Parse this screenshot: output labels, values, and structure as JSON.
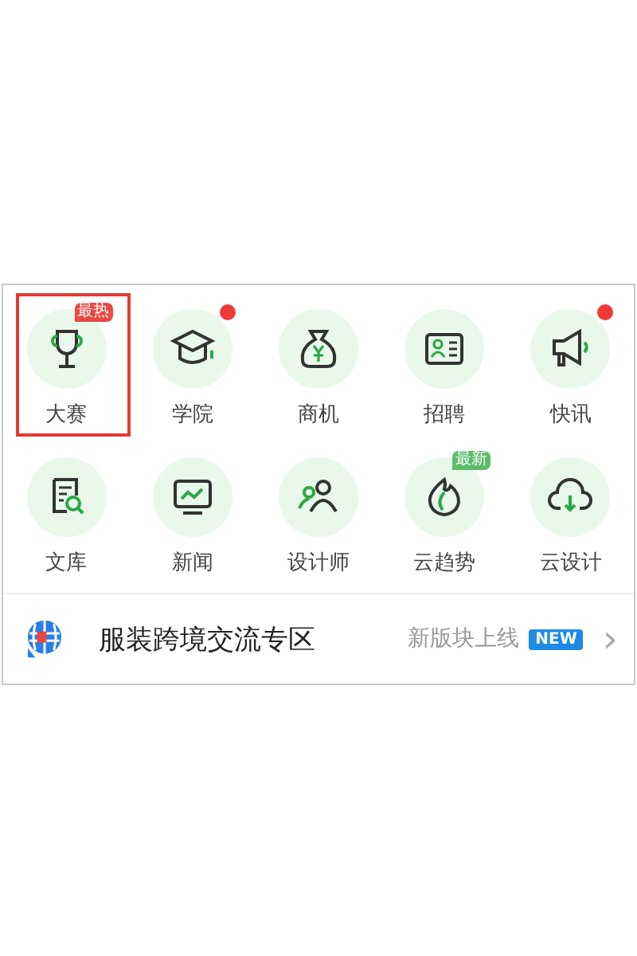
{
  "grid": [
    {
      "label": "大赛",
      "highlighted": true,
      "badge": {
        "kind": "tag",
        "text": "最热",
        "color": "#e94843"
      }
    },
    {
      "label": "学院",
      "highlighted": false,
      "badge": {
        "kind": "dot",
        "color": "#f03a35"
      }
    },
    {
      "label": "商机",
      "highlighted": false
    },
    {
      "label": "招聘",
      "highlighted": false
    },
    {
      "label": "快讯",
      "highlighted": false,
      "badge": {
        "kind": "dot",
        "color": "#f03a35"
      }
    },
    {
      "label": "文库",
      "highlighted": false
    },
    {
      "label": "新闻",
      "highlighted": false
    },
    {
      "label": "设计师",
      "highlighted": false
    },
    {
      "label": "云趋势",
      "highlighted": false,
      "badge": {
        "kind": "tag",
        "text": "最新",
        "color": "#5bbd6c"
      }
    },
    {
      "label": "云设计",
      "highlighted": false
    }
  ],
  "banner": {
    "title": "服装跨境交流专区",
    "subtitle": "新版块上线",
    "tag": "NEW",
    "chevron": "›"
  }
}
